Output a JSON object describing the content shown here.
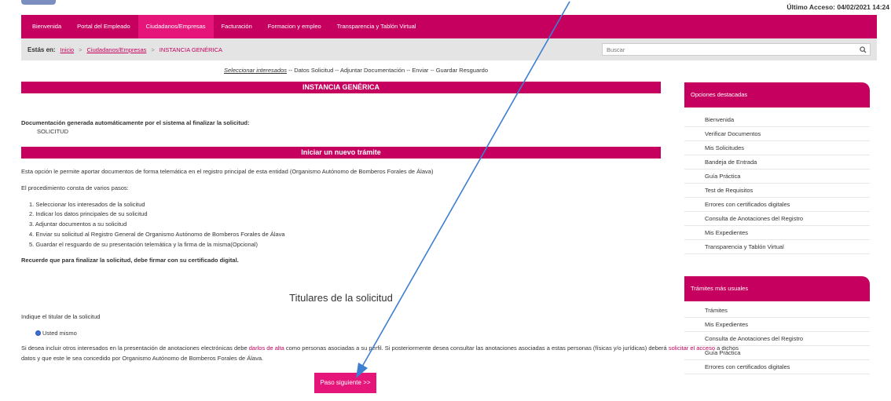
{
  "header": {
    "last_access": "Último Acceso: 04/02/2021 14:24"
  },
  "nav": [
    {
      "label": "Bienvenida",
      "active": false
    },
    {
      "label": "Portal del Empleado",
      "active": false
    },
    {
      "label": "Ciudadanos/Empresas",
      "active": true
    },
    {
      "label": "Facturación",
      "active": false
    },
    {
      "label": "Formacion y empleo",
      "active": false
    },
    {
      "label": "Transparencia y Tablón Virtual",
      "active": false
    }
  ],
  "breadcrumb": {
    "label": "Estás en:",
    "items": [
      "Inicio",
      "Ciudadanos/Empresas"
    ],
    "current": "INSTANCIA GENÉRICA",
    "separator": ">"
  },
  "search": {
    "placeholder": "Buscar"
  },
  "steps": {
    "current": "Seleccionar interesados",
    "rest": " -- Datos Solicitud -- Adjuntar Documentación -- Enviar -- Guardar Resguardo"
  },
  "instance": {
    "title": "INSTANCIA GENÉRICA",
    "doc_label": "Documentación generada automáticamente por el sistema al finalizar la solicitud:",
    "doc_value": "SOLICITUD"
  },
  "new_procedure": {
    "title": "Iniciar un nuevo trámite",
    "intro": "Esta opción le permite aportar documentos de forma telemática en el registro principal de esta entidad (Organismo Autónomo de Bomberos Forales de Álava)",
    "steps_label": "El procedimiento consta de varios pasos:",
    "steps": [
      "1. Seleccionar los interesados de la solicitud",
      "2. Indicar los datos principales de su solicitud",
      "3. Adjuntar documentos a su solicitud",
      "4. Enviar su solicitud al Registro General de Organismo Autónomo de Bomberos Forales de Álava",
      "5. Guardar el resguardo de su presentación telemática y la firma de la misma(Opcional)"
    ],
    "reminder": "Recuerde que para finalizar la solicitud, debe firmar con su certificado digital."
  },
  "holders": {
    "title": "Titulares de la solicitud",
    "prompt": "Indique el titular de la solicitud",
    "option": "Usted mismo",
    "info_a": "Si desea incluir otros interesados en la presentación de anotaciones electrónicas debe ",
    "info_link1": "darlos de alta",
    "info_b": " como personas asociadas a su perfil. Si posteriormente desea consultar las anotaciones asociadas a estas personas (físicas y/o jurídicas) deberá ",
    "info_link2": "solicitar el acceso",
    "info_c": " a dichos",
    "info_line2": "datos y que este le sea concedido por Organismo Autónomo de Bomberos Forales de Álava."
  },
  "next_button": "Paso siguiente >>",
  "featured": {
    "title": "Opciones destacadas",
    "items": [
      "Bienvenida",
      "Verificar Documentos",
      "Mis Solicitudes",
      "Bandeja de Entrada",
      "Guía Práctica",
      "Test de Requisitos",
      "Errores con certificados digitales",
      "Consulta de Anotaciones del Registro",
      "Mis Expedientes",
      "Transparencia y Tablón Virtual"
    ]
  },
  "usual": {
    "title": "Trámites más usuales",
    "items": [
      "Trámites",
      "Mis Expedientes",
      "Consulta de Anotaciones del Registro",
      "Guía Práctica",
      "Errores con certificados digitales"
    ]
  },
  "colors": {
    "brand": "#c6005e",
    "brand_light": "#e5157a",
    "annotation_arrow": "#3d7fd0"
  }
}
